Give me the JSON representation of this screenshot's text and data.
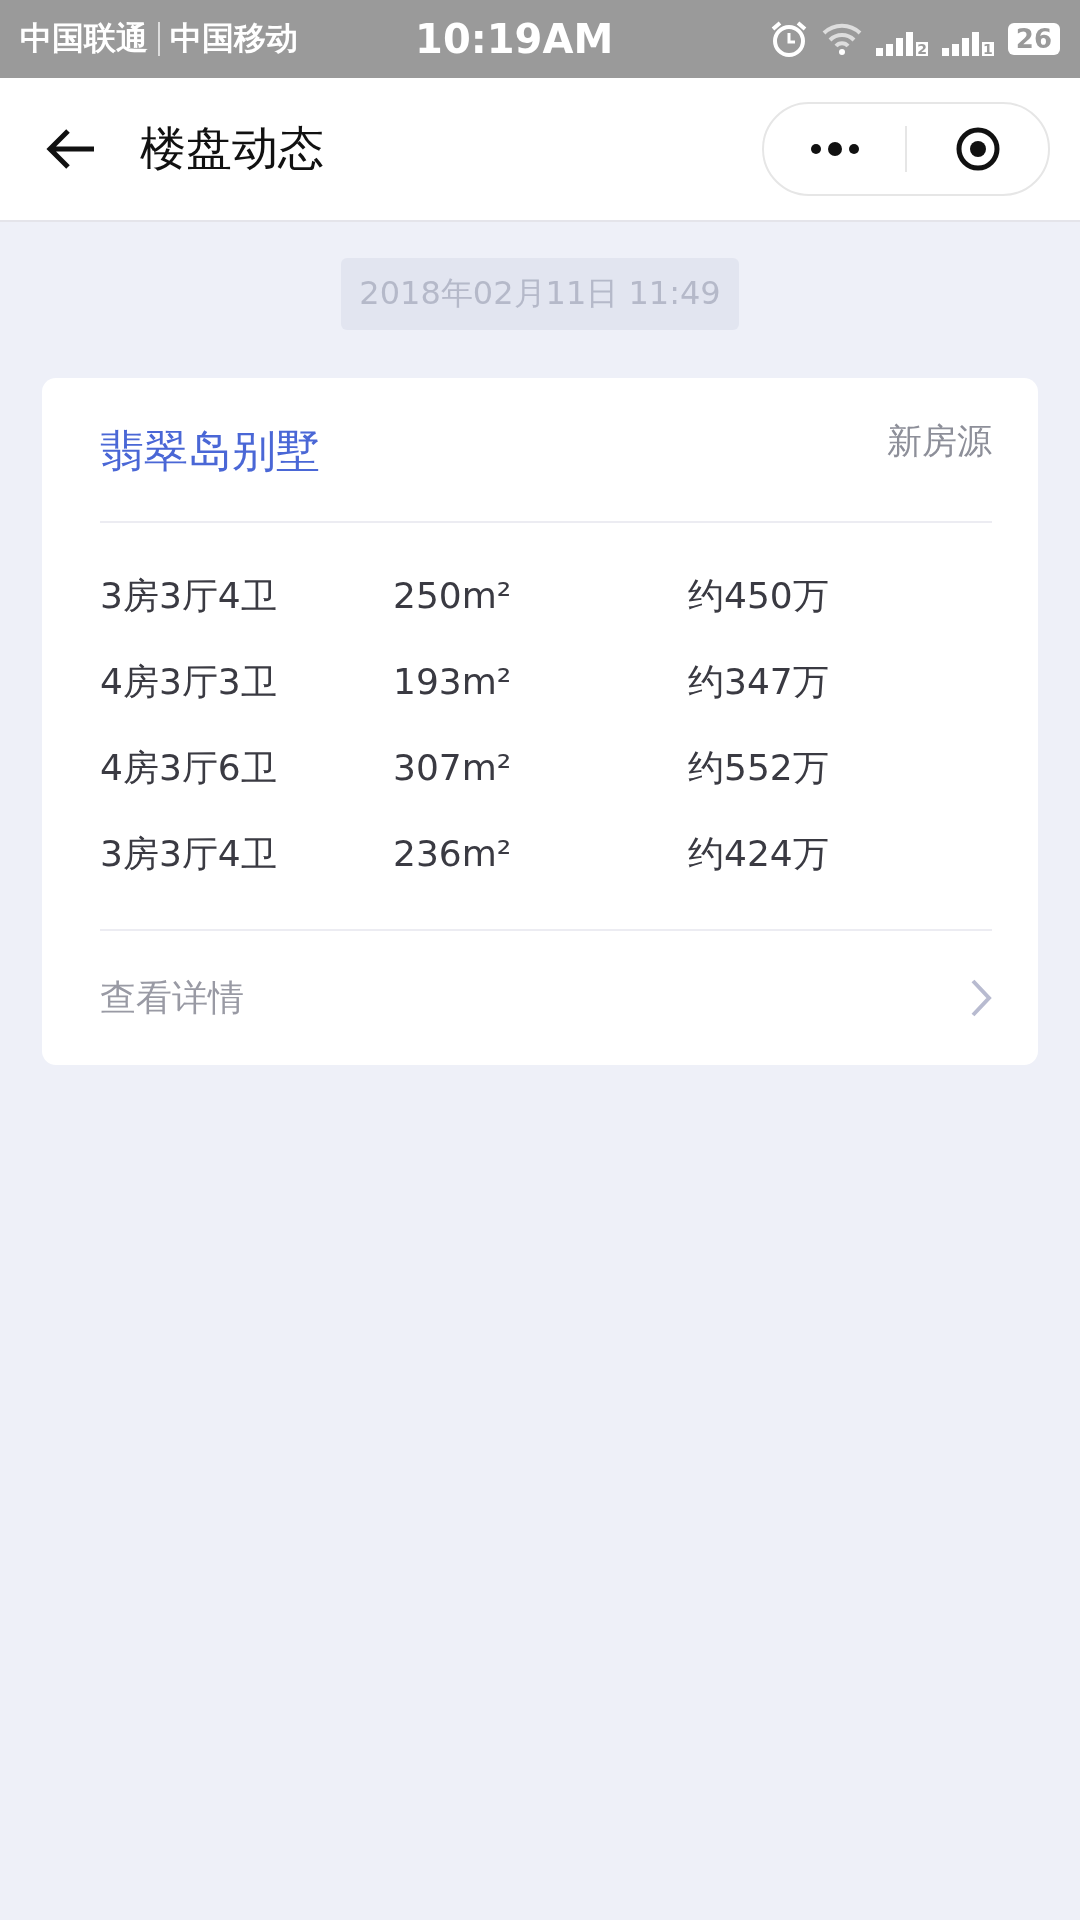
{
  "status_bar": {
    "carriers": [
      "中国联通",
      "中国移动"
    ],
    "time": "10:19AM",
    "sim_signals": [
      "2",
      "1"
    ],
    "battery": "26"
  },
  "nav_bar": {
    "title": "楼盘动态"
  },
  "timestamp": "2018年02月11日 11:49",
  "card": {
    "title": "翡翠岛别墅",
    "tag": "新房源",
    "rows": [
      {
        "layout": "3房3厅4卫",
        "area": "250m²",
        "price": "约450万"
      },
      {
        "layout": "4房3厅3卫",
        "area": "193m²",
        "price": "约347万"
      },
      {
        "layout": "4房3厅6卫",
        "area": "307m²",
        "price": "约552万"
      },
      {
        "layout": "3房3厅4卫",
        "area": "236m²",
        "price": "约424万"
      }
    ],
    "footer_link": "查看详情"
  }
}
